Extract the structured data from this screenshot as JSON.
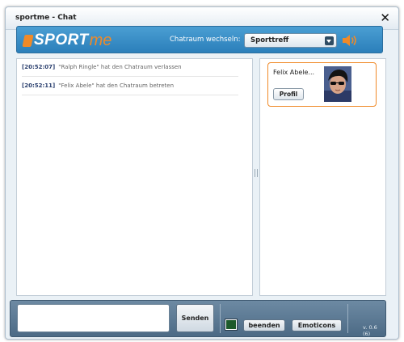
{
  "window": {
    "title": "sportme - Chat",
    "close_icon": "close-icon"
  },
  "header": {
    "logo_sport": "SPORT",
    "logo_me": "me",
    "switch_label": "Chatraum wechseln:",
    "room_selected": "Sporttreff",
    "sound_icon": "speaker-icon"
  },
  "messages": [
    {
      "time": "[20:52:07]",
      "text": "\"Ralph Ringle\" hat den Chatraum verlassen"
    },
    {
      "time": "[20:52:11]",
      "text": "\"Felix Abele\" hat den Chatraum betreten"
    }
  ],
  "users": [
    {
      "name": "Felix Abele...",
      "profile_label": "Profil"
    }
  ],
  "bottom": {
    "send_label": "Senden",
    "quit_label": "beenden",
    "emoticons_label": "Emoticons",
    "version": "v. 0.6 (6)"
  },
  "colors": {
    "accent_orange": "#f08a28",
    "header_blue": "#2b7fba",
    "font_color_swatch": "#1d5a2b"
  }
}
